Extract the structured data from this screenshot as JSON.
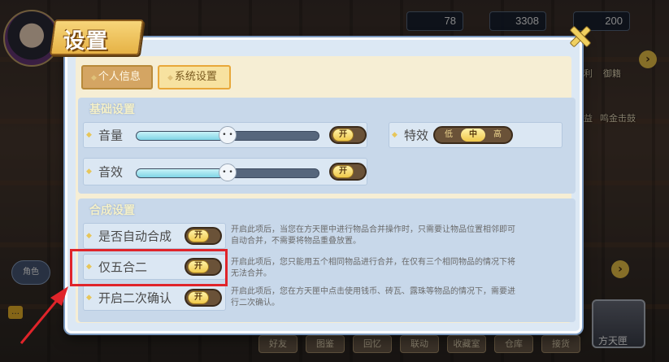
{
  "background": {
    "resources": [
      "78",
      "3308",
      "200"
    ],
    "side_labels": [
      "利",
      "御籍",
      "益",
      "鸣金击鼓"
    ],
    "left_small_label": "角色",
    "bottom_buttons": [
      "好友",
      "图鉴",
      "回忆",
      "联动",
      "收藏室",
      "仓库",
      "接货"
    ],
    "chest_label": "方天匣"
  },
  "dialog": {
    "title": "设置",
    "tabs": [
      {
        "label": "个人信息",
        "selected": false
      },
      {
        "label": "系统设置",
        "selected": true
      }
    ],
    "basic_section": {
      "title": "基础设置",
      "volume": {
        "label": "音量",
        "value": 0.5,
        "toggle": "开"
      },
      "sfx": {
        "label": "音效",
        "value": 0.5,
        "toggle": "开"
      },
      "effects": {
        "label": "特效",
        "options": [
          "低",
          "中",
          "高"
        ],
        "selected": "中"
      }
    },
    "merge_section": {
      "title": "合成设置",
      "rows": [
        {
          "label": "是否自动合成",
          "toggle": "开",
          "desc_1": "开启此项后，当您在方天匣中进行物品合并操作时，只需要让物品位置相邻即可",
          "desc_2": "自动合并，不需要将物品重叠放置。"
        },
        {
          "label": "仅五合二",
          "toggle": "开",
          "desc_1": "开启此项后，您只能用五个相同物品进行合并，在仅有三个相同物品的情况下将",
          "desc_2": "无法合并。"
        },
        {
          "label": "开启二次确认",
          "toggle": "开",
          "desc_1": "开启此项后，您在方天匣中点击使用钱币、砖瓦、露珠等物品的情况下，需要进",
          "desc_2": "行二次确认。"
        }
      ]
    }
  },
  "colors": {
    "highlight": "#e0242a",
    "panel": "#dce8f4",
    "toggle_knob": "#f0c84a"
  }
}
